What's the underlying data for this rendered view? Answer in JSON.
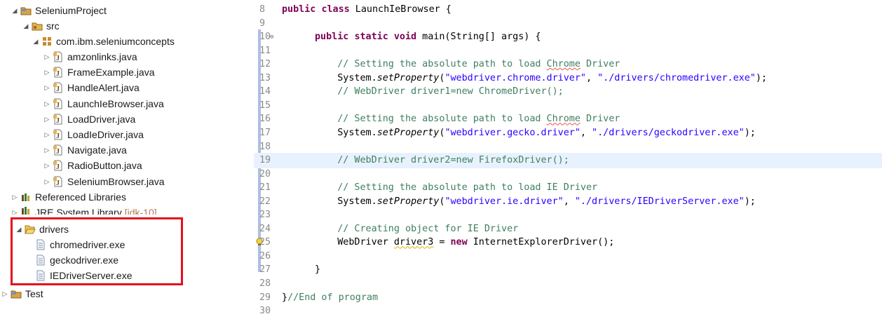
{
  "explorer": {
    "project": "SeleniumProject",
    "src": "src",
    "package": "com.ibm.seleniumconcepts",
    "files": [
      "amzonlinks.java",
      "FrameExample.java",
      "HandleAlert.java",
      "LaunchIeBrowser.java",
      "LoadDriver.java",
      "LoadIeDriver.java",
      "Navigate.java",
      "RadioButton.java",
      "SeleniumBrowser.java"
    ],
    "referenced_libraries": "Referenced Libraries",
    "jre": {
      "name": "JRE System Library",
      "decoration": "[jdk-10]"
    },
    "drivers_folder": "drivers",
    "driver_files": [
      "chromedriver.exe",
      "geckodriver.exe",
      "IEDriverServer.exe"
    ],
    "test_project": "Test"
  },
  "editor": {
    "lines": [
      {
        "n": "8",
        "tokens": [
          [
            "kw",
            "public"
          ],
          [
            "t",
            " "
          ],
          [
            "kw",
            "class"
          ],
          [
            "t",
            " LaunchIeBrowser {"
          ]
        ],
        "indent": "top"
      },
      {
        "n": "9",
        "tokens": []
      },
      {
        "n": "10",
        "tokens": [
          [
            "kw",
            "public"
          ],
          [
            "t",
            " "
          ],
          [
            "kw",
            "static"
          ],
          [
            "t",
            " "
          ],
          [
            "kw",
            "void"
          ],
          [
            "t",
            " main(String[] args) {"
          ]
        ],
        "fold": "⊖"
      },
      {
        "n": "11",
        "tokens": []
      },
      {
        "n": "12",
        "tokens": [
          [
            "cm",
            "    // Setting the absolute path to load "
          ],
          [
            "cm-spell",
            "Chrome"
          ],
          [
            "cm",
            " Driver"
          ]
        ]
      },
      {
        "n": "13",
        "tokens": [
          [
            "t",
            "    System."
          ],
          [
            "it",
            "setProperty"
          ],
          [
            "t",
            "("
          ],
          [
            "str",
            "\"webdriver.chrome.driver\""
          ],
          [
            "t",
            ", "
          ],
          [
            "str",
            "\"./drivers/chromedriver.exe\""
          ],
          [
            "t",
            ");"
          ]
        ]
      },
      {
        "n": "14",
        "tokens": [
          [
            "cm",
            "    // WebDriver driver1=new ChromeDriver();"
          ]
        ]
      },
      {
        "n": "15",
        "tokens": []
      },
      {
        "n": "16",
        "tokens": [
          [
            "cm",
            "    // Setting the absolute path to load "
          ],
          [
            "cm-spell",
            "Chrome"
          ],
          [
            "cm",
            " Driver"
          ]
        ]
      },
      {
        "n": "17",
        "tokens": [
          [
            "t",
            "    System."
          ],
          [
            "it",
            "setProperty"
          ],
          [
            "t",
            "("
          ],
          [
            "str",
            "\"webdriver.gecko.driver\""
          ],
          [
            "t",
            ", "
          ],
          [
            "str",
            "\"./drivers/geckodriver.exe\""
          ],
          [
            "t",
            ");"
          ]
        ]
      },
      {
        "n": "18",
        "tokens": []
      },
      {
        "n": "19",
        "tokens": [
          [
            "cm",
            "    // WebDriver driver2=new FirefoxDriver();"
          ]
        ],
        "current": true
      },
      {
        "n": "20",
        "tokens": []
      },
      {
        "n": "21",
        "tokens": [
          [
            "cm",
            "    // Setting the absolute path to load IE Driver"
          ]
        ]
      },
      {
        "n": "22",
        "tokens": [
          [
            "t",
            "    System."
          ],
          [
            "it",
            "setProperty"
          ],
          [
            "t",
            "("
          ],
          [
            "str",
            "\"webdriver.ie.driver\""
          ],
          [
            "t",
            ", "
          ],
          [
            "str",
            "\"./drivers/IEDriverServer.exe\""
          ],
          [
            "t",
            ");"
          ]
        ]
      },
      {
        "n": "23",
        "tokens": []
      },
      {
        "n": "24",
        "tokens": [
          [
            "cm",
            "    // Creating object for IE Driver"
          ]
        ]
      },
      {
        "n": "25",
        "tokens": [
          [
            "t",
            "    WebDriver "
          ],
          [
            "warn",
            "driver3"
          ],
          [
            "t",
            " = "
          ],
          [
            "kw",
            "new"
          ],
          [
            "t",
            " InternetExplorerDriver();"
          ]
        ],
        "warning": true
      },
      {
        "n": "26",
        "tokens": []
      },
      {
        "n": "27",
        "tokens": [
          [
            "t",
            "}"
          ]
        ]
      },
      {
        "n": "28",
        "tokens": []
      },
      {
        "n": "29",
        "tokens": [
          [
            "t",
            "}"
          ],
          [
            "cm",
            "//End of program"
          ]
        ],
        "indent": "top"
      },
      {
        "n": "30",
        "tokens": []
      }
    ]
  },
  "colors": {
    "keyword": "#7f0055",
    "comment": "#3f7f5f",
    "string": "#2a00ff",
    "highlight_box": "#e3111c",
    "current_line": "#e8f2fe"
  }
}
